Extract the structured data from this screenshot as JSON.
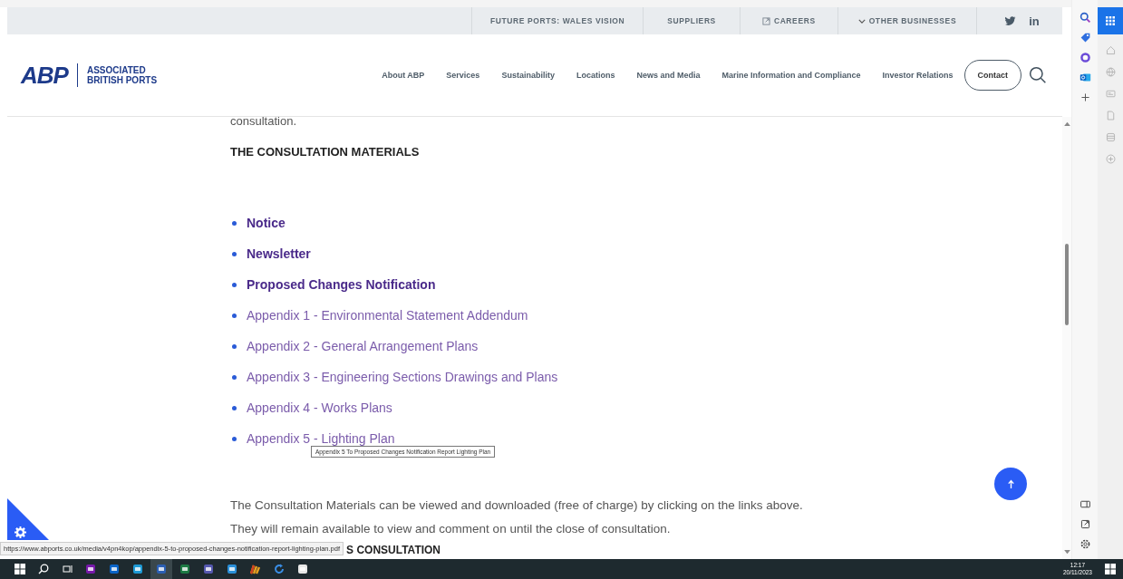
{
  "top_nav": {
    "items": [
      {
        "label": "FUTURE PORTS: WALES VISION",
        "kind": "plain"
      },
      {
        "label": "SUPPLIERS",
        "kind": "plain"
      },
      {
        "label": "CAREERS",
        "kind": "external"
      },
      {
        "label": "OTHER BUSINESSES",
        "kind": "dropdown"
      }
    ],
    "social": [
      {
        "kind": "twitter"
      },
      {
        "kind": "linkedin",
        "label": "in"
      }
    ]
  },
  "logo": {
    "mark": "ABP",
    "name_lines": [
      "ASSOCIATED",
      "BRITISH PORTS"
    ]
  },
  "main_nav": {
    "items": [
      "About ABP",
      "Services",
      "Sustainability",
      "Locations",
      "News and Media",
      "Marine Information and Compliance",
      "Investor Relations"
    ],
    "contact": "Contact"
  },
  "content": {
    "intro": "consultation.",
    "heading": "THE CONSULTATION MATERIALS",
    "links": [
      {
        "label": "Notice",
        "kind": "primary"
      },
      {
        "label": "Newsletter",
        "kind": "primary"
      },
      {
        "label": "Proposed Changes Notification",
        "kind": "primary"
      },
      {
        "label": "Appendix 1 - Environmental Statement Addendum",
        "kind": "appendix"
      },
      {
        "label": "Appendix 2 - General Arrangement Plans",
        "kind": "appendix"
      },
      {
        "label": "Appendix 3 - Engineering Sections Drawings and Plans",
        "kind": "appendix"
      },
      {
        "label": "Appendix 4 - Works Plans",
        "kind": "appendix"
      },
      {
        "label": "Appendix 5 - Lighting Plan",
        "kind": "appendix"
      }
    ],
    "tooltip": "Appendix 5 To Proposed Changes Notification Report Lighting Plan",
    "paragraph_lines": [
      "The Consultation Materials can be viewed and downloaded (free of charge) by clicking on the links above.",
      "They will remain available to view and comment on until the close of consultation."
    ],
    "next_heading": "S CONSULTATION",
    "status_url": "https://www.abports.co.uk/media/v4pn4kop/appendix-5-to-proposed-changes-notification-report-lighting-plan.pdf"
  },
  "taskbar": {
    "apps": [
      {
        "kind": "start",
        "selected": false
      },
      {
        "kind": "search",
        "selected": false
      },
      {
        "kind": "taskview",
        "selected": false
      },
      {
        "kind": "onenote",
        "selected": false
      },
      {
        "kind": "outlook",
        "selected": false
      },
      {
        "kind": "edge",
        "selected": false
      },
      {
        "kind": "word",
        "selected": true
      },
      {
        "kind": "excel",
        "selected": false
      },
      {
        "kind": "teams",
        "selected": false
      },
      {
        "kind": "people",
        "selected": false
      },
      {
        "kind": "chart",
        "selected": false
      },
      {
        "kind": "refresh",
        "selected": false
      },
      {
        "kind": "zip",
        "selected": false
      }
    ],
    "time": "12:17",
    "date": "20/11/2023"
  }
}
